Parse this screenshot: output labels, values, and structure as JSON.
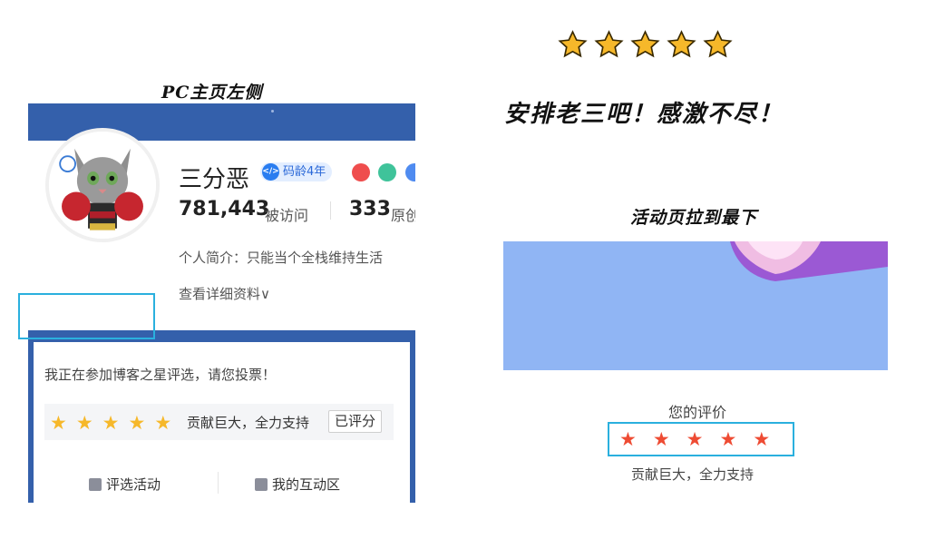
{
  "captions": {
    "left": "PC主页左侧",
    "thanks": "安排老三吧！感激不尽！",
    "right": "活动页拉到最下"
  },
  "top_stars": {
    "icon": "star-icon",
    "count": 5,
    "color": "#f6b82a"
  },
  "profile": {
    "username": "三分恶",
    "code_age": "码龄4年",
    "visits_value": "781,443",
    "visits_label": "被访问",
    "posts_value": "333",
    "posts_label": "原创",
    "bio": "个人简介：只能当个全栈维持生活",
    "details_link": "查看详细资料∨",
    "avatar_icon": "cat-boxer-avatar",
    "banner_color": "#3460ab"
  },
  "vote_card": {
    "prompt": "我正在参加博客之星评选，请您投票！",
    "rating_stars": 5,
    "star_color": "#f6b82a",
    "rating_text": "贡献巨大，全力支持",
    "rated_button": "已评分",
    "actions": [
      {
        "icon": "document-edit-icon",
        "label": "评选活动"
      },
      {
        "icon": "thumb-up-icon",
        "label": "我的互动区"
      }
    ]
  },
  "activity_page": {
    "your_rating_label": "您的评价",
    "rating_stars": 5,
    "star_color": "#ee4b33",
    "rating_text": "贡献巨大，全力支持"
  },
  "colors": {
    "highlight": "#2ab0de",
    "accent_blue": "#2a68d8"
  }
}
